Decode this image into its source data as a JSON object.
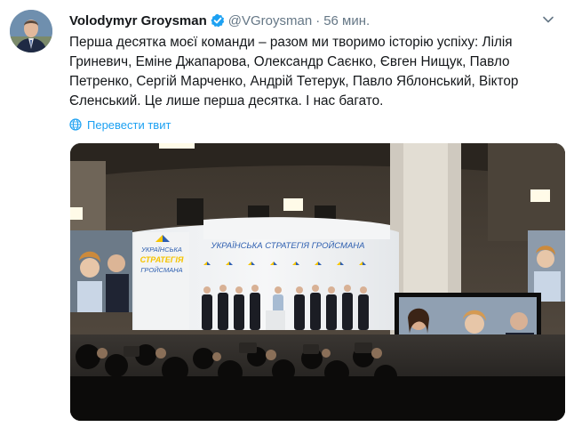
{
  "tweet": {
    "author": {
      "name": "Volodymyr Groysman",
      "handle": "@VGroysman",
      "verified": true,
      "avatar_icon": "profile-photo"
    },
    "separator": "·",
    "time": "56 мин.",
    "text": "Перша десятка моєї команди – разом ми творимо історію успіху: Лілія Гриневич, Еміне Джапарова, Олександр Саєнко, Євген Нищук, Павло Петренко, Сергій Марченко, Андрій Тетерук, Павло Яблонський, Віктор Єленський. Це лише перша десятка. І нас багато.",
    "translate_label": "Перевести твит",
    "media": {
      "banner_left_lines": [
        "УКРАЇНСЬКА",
        "СТРАТЕГІЯ",
        "ГРОЙСМАНА"
      ],
      "banner_center_text": "УКРАЇНСЬКА СТРАТЕГІЯ ГРОЙСМАНА"
    }
  },
  "colors": {
    "link": "#1da1f2",
    "secondary_text": "#657786",
    "verified_badge": "#1da1f2"
  }
}
